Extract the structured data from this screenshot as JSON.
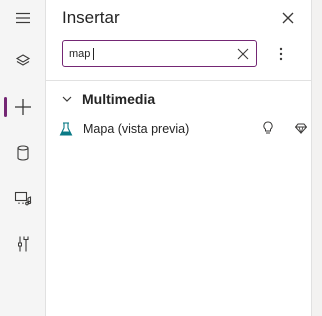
{
  "rail": {
    "items": [
      {
        "icon": "hamburger-menu-icon"
      },
      {
        "icon": "layers-icon"
      },
      {
        "icon": "plus-icon",
        "active": true
      },
      {
        "icon": "database-icon"
      },
      {
        "icon": "media-icon"
      },
      {
        "icon": "tools-icon"
      }
    ]
  },
  "panel": {
    "title": "Insertar",
    "search": {
      "value": "map"
    },
    "group": {
      "label": "Multimedia"
    },
    "results": [
      {
        "label": "Mapa (vista previa)",
        "icon": "flask-icon",
        "badges": [
          "lightbulb-icon",
          "diamond-icon"
        ]
      }
    ]
  },
  "colors": {
    "accent": "#742774",
    "icon_teal": "#0a7a86"
  }
}
